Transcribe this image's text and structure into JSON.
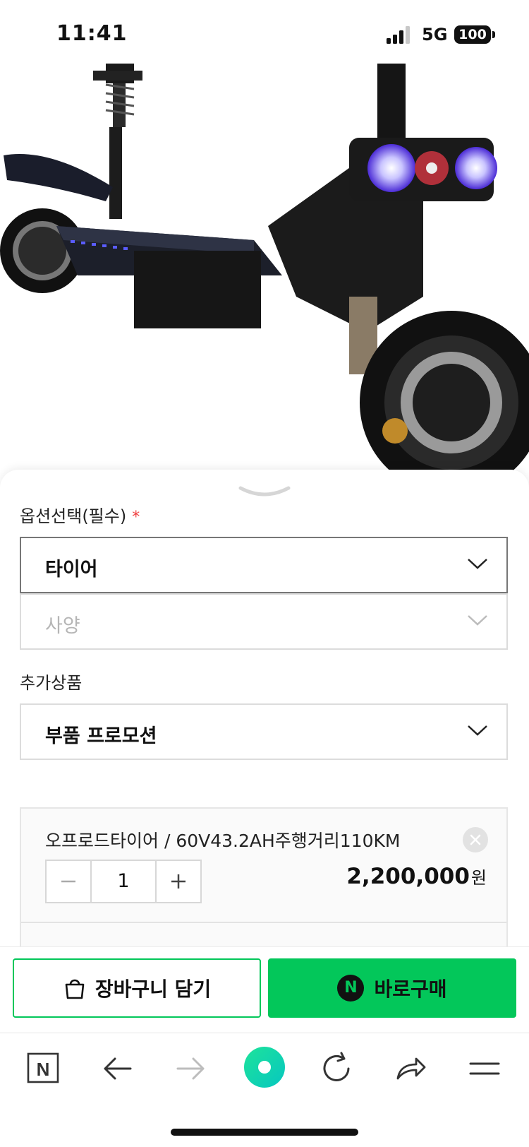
{
  "status_bar": {
    "time": "11:41",
    "network": "5G",
    "battery": "100"
  },
  "product_image": {
    "description_icon": "electric-scooter-photo"
  },
  "options": {
    "label": "옵션선택(필수)",
    "required_mark": "*",
    "select1_value": "타이어",
    "select2_placeholder": "사양"
  },
  "addons": {
    "label": "추가상품",
    "select_value": "부품 프로모션"
  },
  "selected_item": {
    "title": "오프로드타이어 / 60V43.2AH주행거리110KM",
    "quantity": "1",
    "price": "2,200,000",
    "currency": "원"
  },
  "actions": {
    "cart_label": "장바구니 담기",
    "buy_badge": "N",
    "buy_label": "바로구매"
  },
  "browser_toolbar": {
    "home_badge": "N"
  },
  "colors": {
    "accent": "#03c75a",
    "required": "#ef3f3f"
  }
}
